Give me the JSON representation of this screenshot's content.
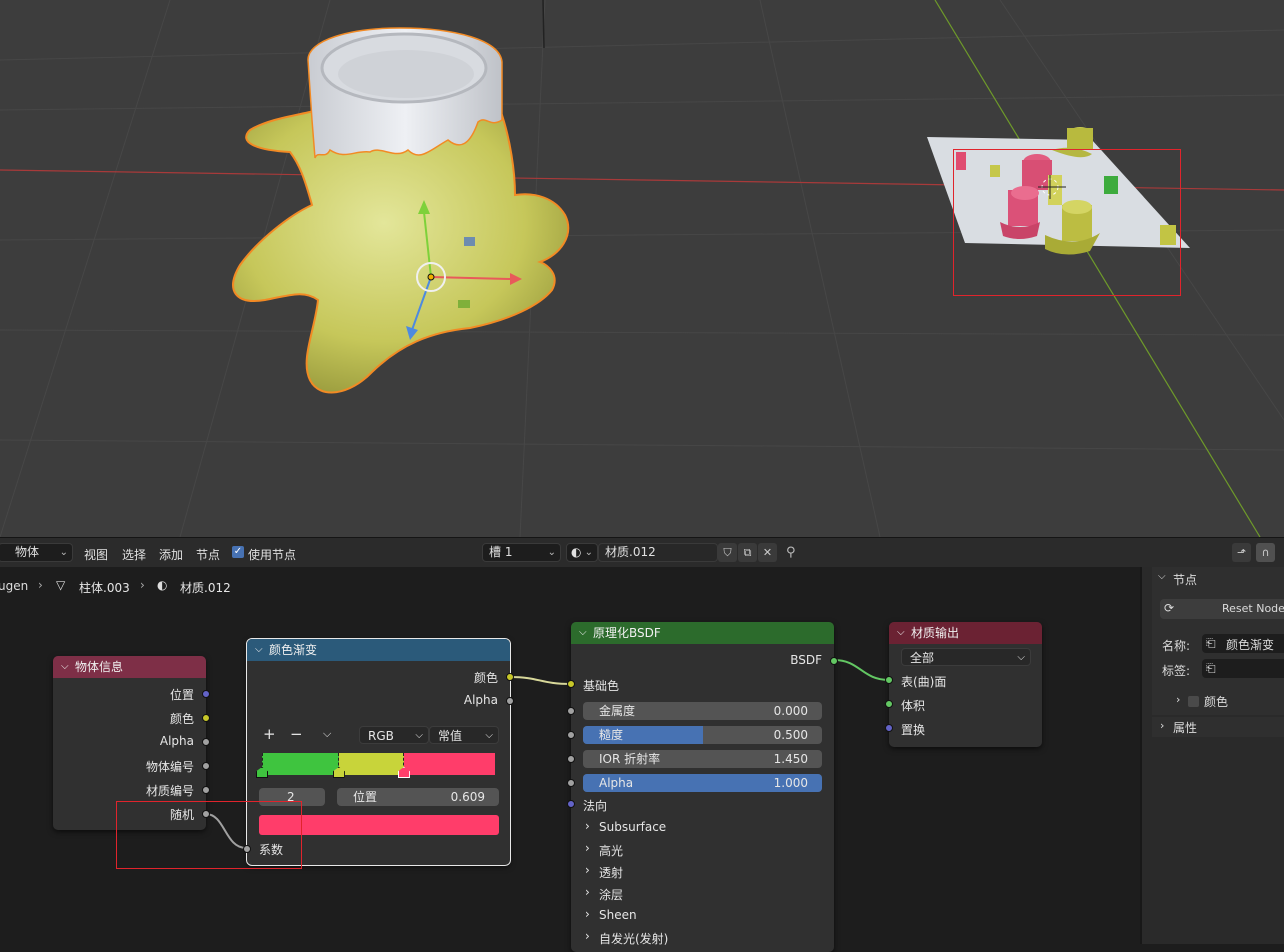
{
  "header": {
    "editor_type": "物体",
    "menu": [
      "视图",
      "选择",
      "添加",
      "节点"
    ],
    "use_nodes_label": "使用节点",
    "slot": "槽 1",
    "material_name": "材质.012"
  },
  "breadcrumb": {
    "root": "ugen",
    "object": "柱体.003",
    "material": "材质.012"
  },
  "nodes": {
    "object_info": {
      "title": "物体信息",
      "outputs": [
        "位置",
        "颜色",
        "Alpha",
        "物体编号",
        "材质编号",
        "随机"
      ]
    },
    "color_ramp": {
      "title": "颜色渐变",
      "outputs": [
        "颜色",
        "Alpha"
      ],
      "add_symbol": "+",
      "remove_symbol": "−",
      "color_mode": "RGB",
      "interpolation": "常值",
      "stop_index": "2",
      "position_label": "位置",
      "position_value": "0.609",
      "input_label": "系数",
      "stops": [
        {
          "pos": 0.0,
          "color": "#3fc43f"
        },
        {
          "pos": 0.33,
          "color": "#c8d43a"
        },
        {
          "pos": 0.609,
          "color": "#ff3d6a"
        }
      ],
      "selected_color": "#ff3d6a"
    },
    "principled": {
      "title": "原理化BSDF",
      "output": "BSDF",
      "base_color_label": "基础色",
      "fields": [
        {
          "label": "金属度",
          "value": "0.000",
          "fill": 0.0
        },
        {
          "label": "糙度",
          "value": "0.500",
          "fill": 0.5
        },
        {
          "label": "IOR 折射率",
          "value": "1.450",
          "fill": 0.0
        },
        {
          "label": "Alpha",
          "value": "1.000",
          "fill": 1.0
        }
      ],
      "normal_label": "法向",
      "panels": [
        "Subsurface",
        "高光",
        "透射",
        "涂层",
        "Sheen",
        "自发光(发射)"
      ]
    },
    "material_output": {
      "title": "材质输出",
      "target": "全部",
      "inputs": [
        "表(曲)面",
        "体积",
        "置换"
      ]
    }
  },
  "sidebar": {
    "section_node": "节点",
    "reset_button": "Reset Node",
    "name_label": "名称:",
    "name_value": "颜色渐变",
    "tag_label": "标签:",
    "color_label": "颜色",
    "section_props": "属性"
  },
  "colors": {
    "object_info_header": "#7e2f47",
    "color_ramp_header": "#2b5a7a",
    "principled_header": "#2c6b2c",
    "material_output_header": "#6b2233",
    "accent_blue": "#4772b3",
    "socket_yellow": "#c7c729",
    "socket_grey": "#a1a1a1",
    "socket_green": "#63c763",
    "socket_purple": "#6363c7",
    "highlight_red": "#e0242c"
  }
}
